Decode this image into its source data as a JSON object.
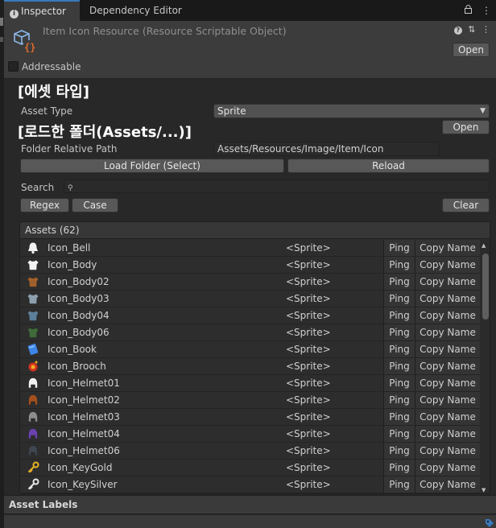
{
  "tabs": {
    "inspector": "Inspector",
    "dependency_editor": "Dependency Editor"
  },
  "header": {
    "title": "Item Icon Resource (Resource Scriptable Object)",
    "open_label": "Open",
    "addressable_label": "Addressable"
  },
  "asset_type_section": {
    "heading": "[에셋 타입]",
    "label": "Asset Type",
    "value": "Sprite"
  },
  "folder_section": {
    "heading": "[로드한 폴더(Assets/...)]",
    "open_label": "Open",
    "label": "Folder Relative Path",
    "value": "Assets/Resources/Image/Item/Icon",
    "load_folder_label": "Load Folder (Select)",
    "reload_label": "Reload"
  },
  "search": {
    "label": "Search",
    "value": "",
    "regex_label": "Regex",
    "case_label": "Case",
    "clear_label": "Clear"
  },
  "assets": {
    "header": "Assets (62)",
    "ping_label": "Ping",
    "copy_name_label": "Copy Name",
    "rows": [
      {
        "name": "Icon_Bell",
        "type": "<Sprite>",
        "icon": "bell-icon",
        "color": "#f2f2f2"
      },
      {
        "name": "Icon_Body",
        "type": "<Sprite>",
        "icon": "body-armor-icon",
        "color": "#f2f2f2"
      },
      {
        "name": "Icon_Body02",
        "type": "<Sprite>",
        "icon": "body-armor-icon",
        "color": "#a0602c"
      },
      {
        "name": "Icon_Body03",
        "type": "<Sprite>",
        "icon": "body-armor-icon",
        "color": "#8da0ad"
      },
      {
        "name": "Icon_Body04",
        "type": "<Sprite>",
        "icon": "body-armor-icon",
        "color": "#5d7f9a"
      },
      {
        "name": "Icon_Body06",
        "type": "<Sprite>",
        "icon": "body-armor-icon",
        "color": "#3f6a3a"
      },
      {
        "name": "Icon_Book",
        "type": "<Sprite>",
        "icon": "book-icon",
        "color": "#3d86e8"
      },
      {
        "name": "Icon_Brooch",
        "type": "<Sprite>",
        "icon": "brooch-icon",
        "color": "#d0341f"
      },
      {
        "name": "Icon_Helmet01",
        "type": "<Sprite>",
        "icon": "helmet-icon",
        "color": "#f2f2f2"
      },
      {
        "name": "Icon_Helmet02",
        "type": "<Sprite>",
        "icon": "helmet-icon",
        "color": "#a3501e"
      },
      {
        "name": "Icon_Helmet03",
        "type": "<Sprite>",
        "icon": "helmet-icon",
        "color": "#8d8d8d"
      },
      {
        "name": "Icon_Helmet04",
        "type": "<Sprite>",
        "icon": "helmet-icon",
        "color": "#6a42b0"
      },
      {
        "name": "Icon_Helmet06",
        "type": "<Sprite>",
        "icon": "helmet-icon",
        "color": "#3f4650"
      },
      {
        "name": "Icon_KeyGold",
        "type": "<Sprite>",
        "icon": "key-icon",
        "color": "#e8b226"
      },
      {
        "name": "Icon_KeySilver",
        "type": "<Sprite>",
        "icon": "key-icon",
        "color": "#e6e6e6"
      }
    ]
  },
  "asset_labels": {
    "title": "Asset Labels"
  }
}
